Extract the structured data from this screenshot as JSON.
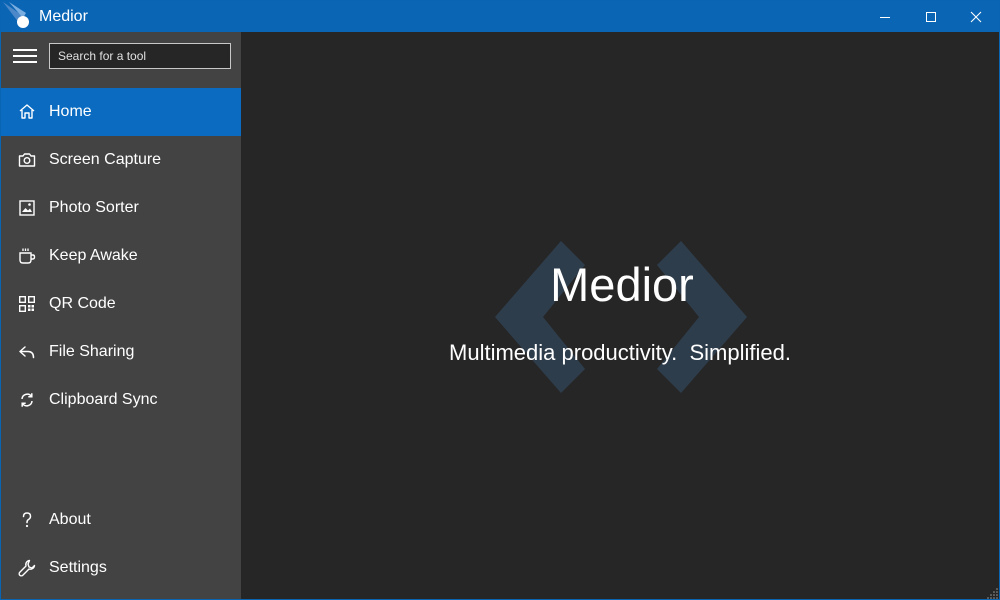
{
  "window": {
    "title": "Medior",
    "controls": {
      "minimize_icon": "minimize-icon",
      "maximize_icon": "maximize-icon",
      "close_icon": "close-icon"
    }
  },
  "sidebar": {
    "menu_icon": "hamburger-icon",
    "search": {
      "placeholder": "Search for a tool",
      "value": ""
    },
    "items": [
      {
        "label": "Home",
        "icon": "home-icon",
        "active": true
      },
      {
        "label": "Screen Capture",
        "icon": "camera-icon",
        "active": false
      },
      {
        "label": "Photo Sorter",
        "icon": "photo-icon",
        "active": false
      },
      {
        "label": "Keep Awake",
        "icon": "coffee-cup-icon",
        "active": false
      },
      {
        "label": "QR Code",
        "icon": "qr-code-icon",
        "active": false
      },
      {
        "label": "File Sharing",
        "icon": "share-icon",
        "active": false
      },
      {
        "label": "Clipboard Sync",
        "icon": "sync-icon",
        "active": false
      }
    ],
    "footer_items": [
      {
        "label": "About",
        "icon": "question-icon"
      },
      {
        "label": "Settings",
        "icon": "wrench-icon"
      }
    ]
  },
  "main": {
    "title": "Medior",
    "subtitle": "Multimedia productivity.  Simplified.",
    "watermark_icon": "code-brackets-icon"
  },
  "colors": {
    "titlebar": "#0a65b5",
    "accent": "#0a6bc1",
    "sidebar": "#434343",
    "content": "#262626",
    "watermark": "#2e3d4c"
  }
}
